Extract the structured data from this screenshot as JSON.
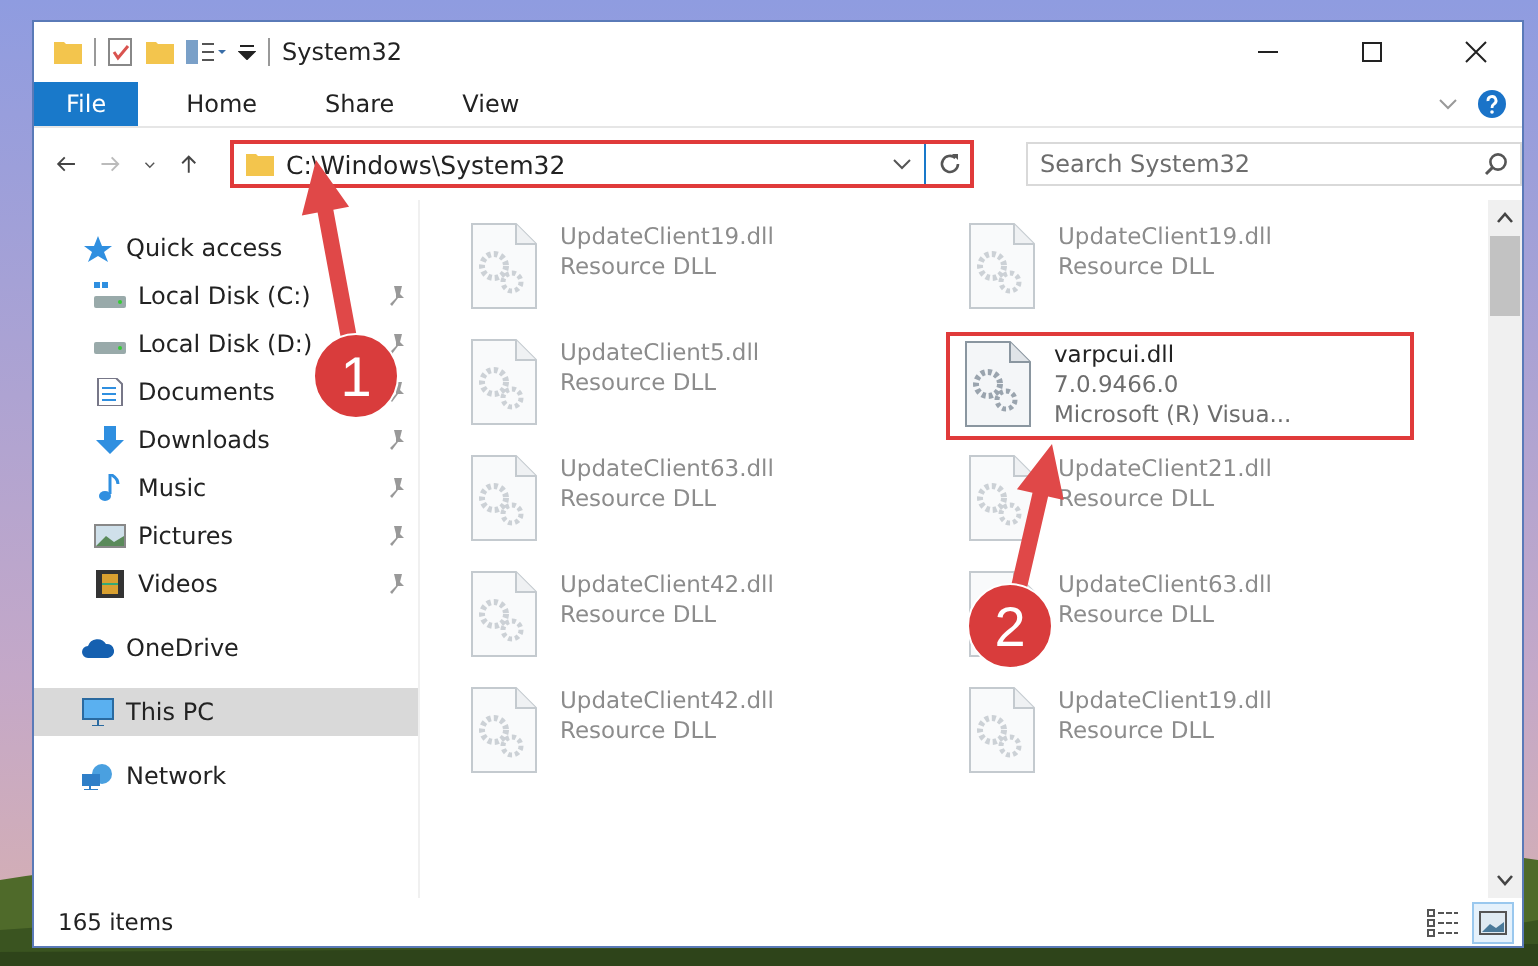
{
  "window": {
    "title": "System32"
  },
  "ribbon_tabs": [
    {
      "label": "File",
      "kind": "file"
    },
    {
      "label": "Home",
      "kind": "tab"
    },
    {
      "label": "Share",
      "kind": "tab"
    },
    {
      "label": "View",
      "kind": "tab"
    }
  ],
  "address_bar": {
    "path": "C:\\Windows\\System32",
    "highlighted": true
  },
  "search": {
    "placeholder": "Search System32"
  },
  "sidebar": {
    "items": [
      {
        "label": "Quick access",
        "kind": "star",
        "selected": false,
        "children": [
          {
            "label": "Local Disk (C:)",
            "kind": "drive-system",
            "pinned": true,
            "selected": false
          },
          {
            "label": "Local Disk (D:)",
            "kind": "drive",
            "pinned": true,
            "selected": false
          },
          {
            "label": "Documents",
            "kind": "documents",
            "pinned": true,
            "selected": false
          },
          {
            "label": "Downloads",
            "kind": "downloads",
            "pinned": true,
            "selected": false
          },
          {
            "label": "Music",
            "kind": "music",
            "pinned": true,
            "selected": false
          },
          {
            "label": "Pictures",
            "kind": "pictures",
            "pinned": true,
            "selected": false
          },
          {
            "label": "Videos",
            "kind": "videos",
            "pinned": true,
            "selected": false
          }
        ]
      },
      {
        "label": "OneDrive",
        "kind": "cloud",
        "selected": false
      },
      {
        "label": "This PC",
        "kind": "pc",
        "selected": true
      },
      {
        "label": "Network",
        "kind": "network",
        "selected": false
      }
    ]
  },
  "files": [
    {
      "name": "UpdateClient19.dll",
      "details": [
        "Resource DLL"
      ],
      "faded": true,
      "highlighted": false
    },
    {
      "name": "UpdateClient19.dll",
      "details": [
        "Resource DLL"
      ],
      "faded": true,
      "highlighted": false
    },
    {
      "name": "UpdateClient5.dll",
      "details": [
        "Resource DLL"
      ],
      "faded": true,
      "highlighted": false
    },
    {
      "name": "varpcui.dll",
      "details": [
        "7.0.9466.0",
        "Microsoft (R) Visua..."
      ],
      "faded": false,
      "highlighted": true
    },
    {
      "name": "UpdateClient63.dll",
      "details": [
        "Resource DLL"
      ],
      "faded": true,
      "highlighted": false
    },
    {
      "name": "UpdateClient21.dll",
      "details": [
        "Resource DLL"
      ],
      "faded": true,
      "highlighted": false
    },
    {
      "name": "UpdateClient42.dll",
      "details": [
        "Resource DLL"
      ],
      "faded": true,
      "highlighted": false
    },
    {
      "name": "UpdateClient63.dll",
      "details": [
        "Resource DLL"
      ],
      "faded": true,
      "highlighted": false
    },
    {
      "name": "UpdateClient42.dll",
      "details": [
        "Resource DLL"
      ],
      "faded": true,
      "highlighted": false
    },
    {
      "name": "UpdateClient19.dll",
      "details": [
        "Resource DLL"
      ],
      "faded": true,
      "highlighted": false
    }
  ],
  "annotations": [
    {
      "label": "1"
    },
    {
      "label": "2"
    }
  ],
  "status_bar": {
    "item_count": "165 items",
    "view_buttons": [
      {
        "kind": "details",
        "selected": false
      },
      {
        "kind": "large-icons",
        "selected": true
      }
    ]
  }
}
